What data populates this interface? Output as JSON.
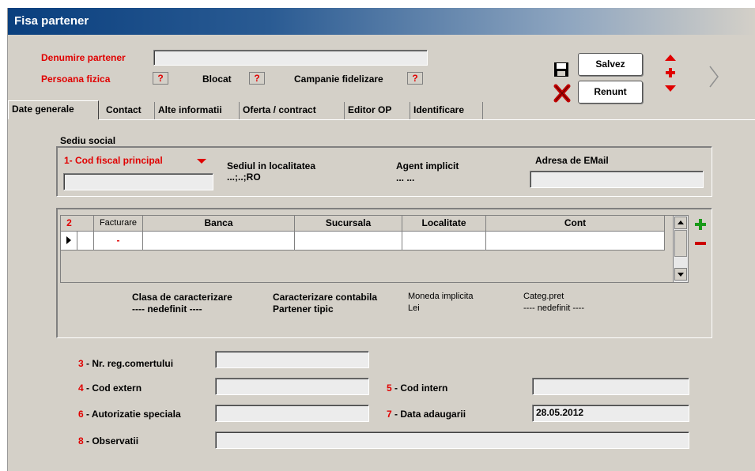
{
  "window": {
    "title": "Fisa partener"
  },
  "header": {
    "denumire_label": "Denumire partener",
    "denumire_value": "",
    "persoana_label": "Persoana fizica",
    "persoana_value": "?",
    "blocat_label": "Blocat",
    "blocat_value": "?",
    "campanie_label": "Campanie fidelizare",
    "campanie_value": "?"
  },
  "toolbar": {
    "save_label": "Salvez",
    "cancel_label": "Renunt"
  },
  "tabs": [
    "Date generale",
    "Contact",
    "Alte informatii",
    "Oferta / contract",
    "Editor OP",
    "Identificare"
  ],
  "sediu": {
    "title": "Sediu social",
    "cod_fiscal_label": "1- Cod fiscal principal",
    "cod_fiscal_value": "",
    "localitate_label": "Sediul in localitatea",
    "localitate_value": "...;..;RO",
    "agent_label": "Agent implicit",
    "agent_value": "...  ...",
    "email_label": "Adresa de EMail",
    "email_value": ""
  },
  "grid": {
    "num": "2",
    "columns": [
      "Facturare",
      "Banca",
      "Sucursala",
      "Localitate",
      "Cont"
    ],
    "row_marker": "-"
  },
  "caracterizare": {
    "clasa_label": "Clasa de caracterizare",
    "clasa_value": "---- nedefinit ----",
    "contabila_label": "Caracterizare contabila",
    "contabila_value": "Partener tipic",
    "moneda_label": "Moneda implicita",
    "moneda_value": "Lei",
    "categ_label": "Categ.pret",
    "categ_value": "---- nedefinit ----"
  },
  "fields": {
    "nr_reg_num": "3",
    "nr_reg_label": " - Nr. reg.comertului",
    "nr_reg_value": "",
    "cod_extern_num": "4",
    "cod_extern_label": " - Cod extern",
    "cod_extern_value": "",
    "cod_intern_num": "5",
    "cod_intern_label": " - Cod intern",
    "cod_intern_value": "",
    "autorizatie_num": "6",
    "autorizatie_label": " - Autorizatie speciala",
    "autorizatie_value": "",
    "data_num": "7",
    "data_label": " - Data adaugarii",
    "data_value": "28.05.2012",
    "obs_num": "8",
    "obs_label": " - Observatii",
    "obs_value": ""
  },
  "colors": {
    "accent_red": "#e00000",
    "plus_green": "#1a9a1a",
    "minus_red": "#cc0000",
    "title_blue": "#0a3f7e"
  }
}
